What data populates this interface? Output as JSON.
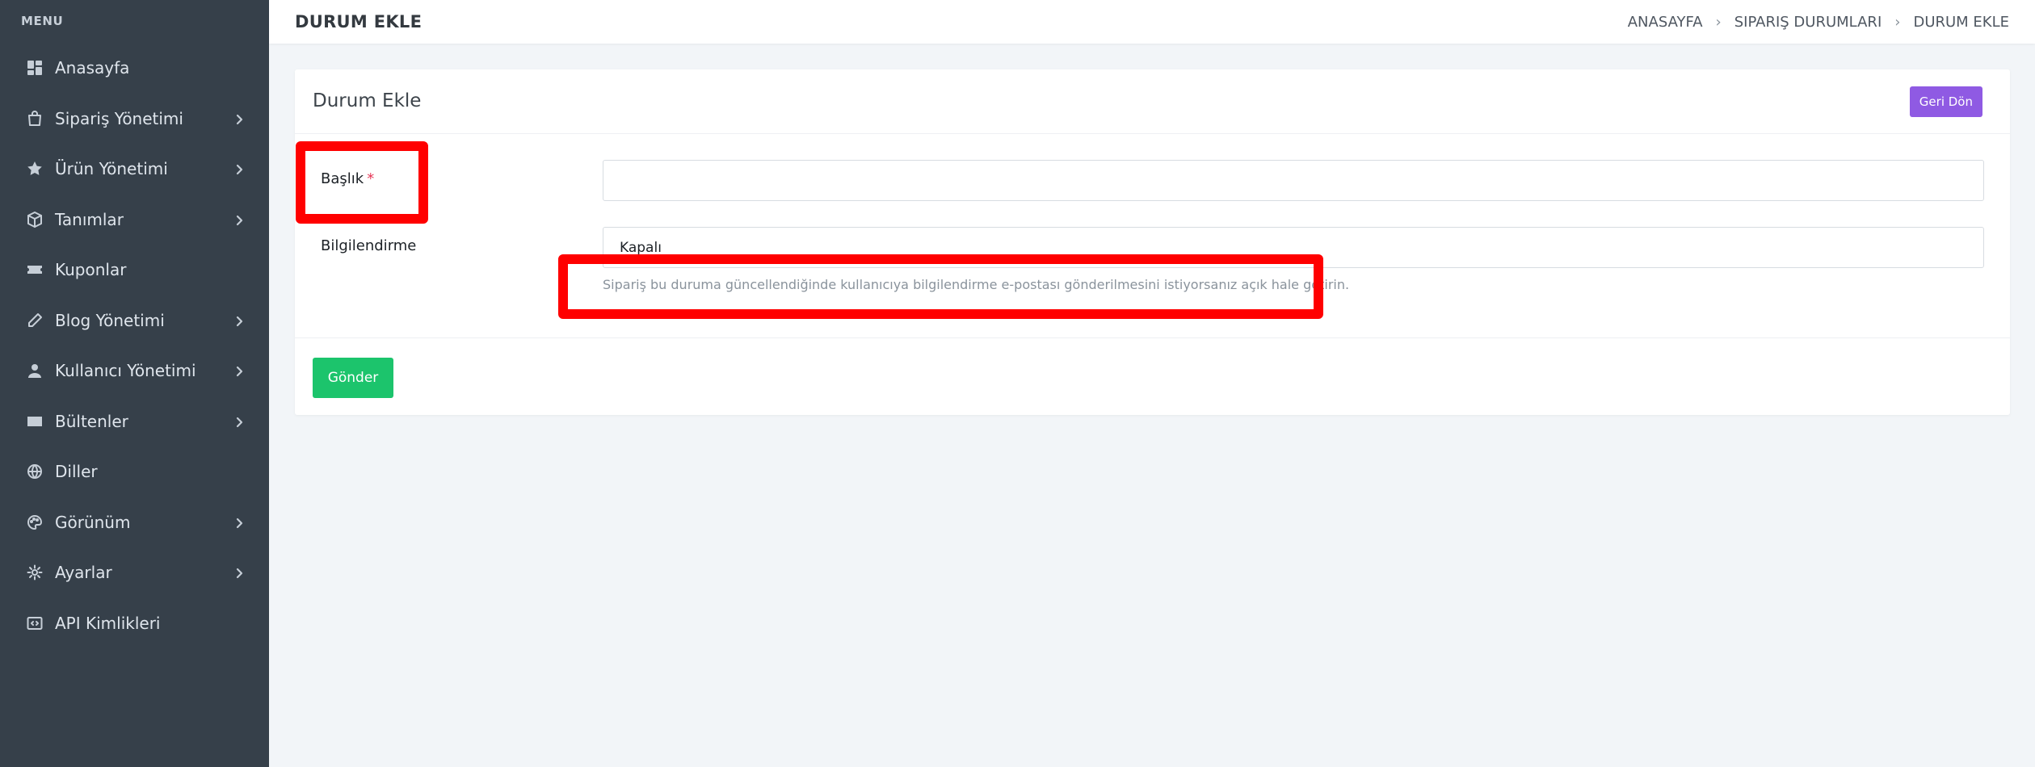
{
  "sidebar": {
    "menu_title": "MENU",
    "items": [
      {
        "label": "Anasayfa",
        "icon": "dashboard-icon",
        "has_children": false
      },
      {
        "label": "Sipariş Yönetimi",
        "icon": "shopping-bag-icon",
        "has_children": true
      },
      {
        "label": "Ürün Yönetimi",
        "icon": "star-icon",
        "has_children": true
      },
      {
        "label": "Tanımlar",
        "icon": "box-icon",
        "has_children": true
      },
      {
        "label": "Kuponlar",
        "icon": "ticket-icon",
        "has_children": false
      },
      {
        "label": "Blog Yönetimi",
        "icon": "pencil-icon",
        "has_children": true
      },
      {
        "label": "Kullanıcı Yönetimi",
        "icon": "user-icon",
        "has_children": true
      },
      {
        "label": "Bültenler",
        "icon": "envelope-icon",
        "has_children": true
      },
      {
        "label": "Diller",
        "icon": "globe-icon",
        "has_children": false
      },
      {
        "label": "Görünüm",
        "icon": "palette-icon",
        "has_children": true
      },
      {
        "label": "Ayarlar",
        "icon": "gear-icon",
        "has_children": true
      },
      {
        "label": "API Kimlikleri",
        "icon": "code-icon",
        "has_children": false
      }
    ]
  },
  "header": {
    "title": "DURUM EKLE",
    "breadcrumb": [
      "ANASAYFA",
      "SIPARIŞ DURUMLARI",
      "DURUM EKLE"
    ]
  },
  "card": {
    "title": "Durum Ekle",
    "back_label": "Geri Dön",
    "fields": {
      "title_label": "Başlık",
      "title_required_mark": "*",
      "title_value": "",
      "notify_label": "Bilgilendirme",
      "notify_value": "Kapalı",
      "notify_help": "Sipariş bu duruma güncellendiğinde kullanıcıya bilgilendirme e-postası gönderilmesini istiyorsanız açık hale getirin."
    },
    "submit_label": "Gönder"
  },
  "colors": {
    "sidebar_bg": "#36404a",
    "back_button": "#8f5ae3",
    "submit_button": "#1cc46c",
    "highlight": "#ff0000"
  }
}
